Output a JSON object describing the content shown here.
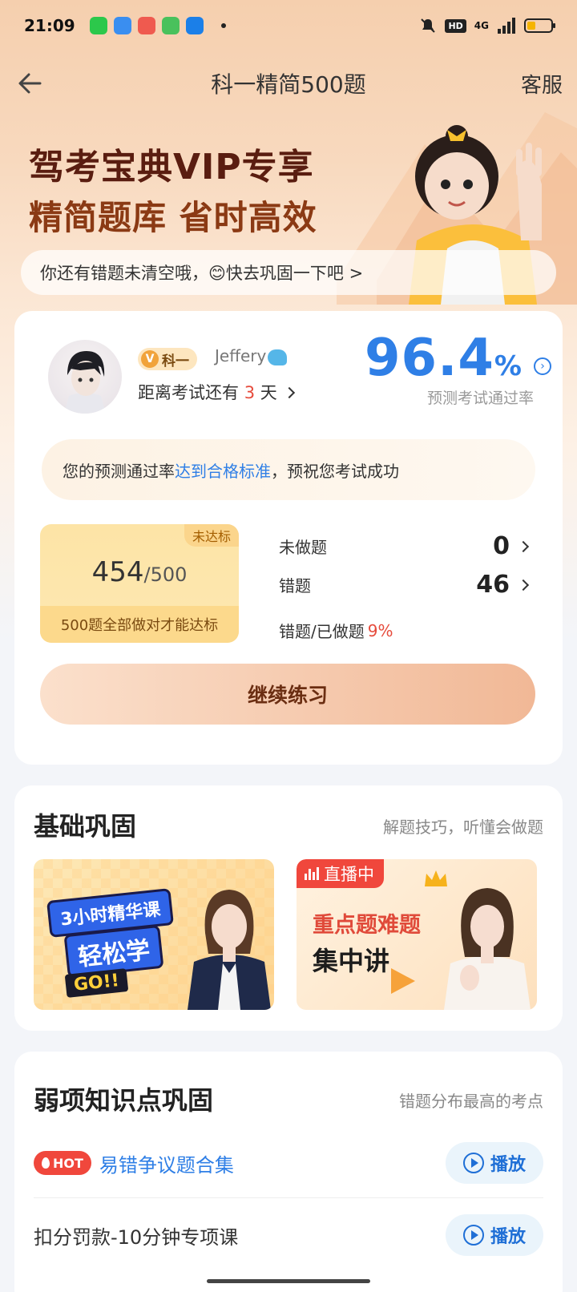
{
  "status_bar": {
    "time": "21:09",
    "hd": "HD",
    "network": "4G",
    "battery_level": 0.35
  },
  "nav": {
    "title": "科一精简500题",
    "right_label": "客服"
  },
  "hero": {
    "line1": "驾考宝典VIP专享",
    "line2": "精简题库 省时高效",
    "tip": "你还有错题未清空哦，😊快去巩固一下吧 >"
  },
  "profile": {
    "subject_badge": "科一",
    "username": "Jeffery",
    "days_prefix": "距离考试还有",
    "days_value": "3",
    "days_suffix": "天",
    "pass_rate_value": "96.4",
    "pass_rate_unit": "%",
    "pass_rate_label": "预测考试通过率"
  },
  "pass_message": {
    "before": "您的预测通过率",
    "highlight": "达到合格标准",
    "after": "，预祝您考试成功"
  },
  "progress": {
    "tag": "未达标",
    "done": "454",
    "total": "/500",
    "footer": "500题全部做对才能达标"
  },
  "stats": {
    "undone_label": "未做题",
    "undone_value": "0",
    "wrong_label": "错题",
    "wrong_value": "46",
    "ratio_label": "错题/已做题",
    "ratio_value": "9%"
  },
  "continue_button": "继续练习",
  "basic": {
    "title": "基础巩固",
    "subtitle": "解题技巧，听懂会做题",
    "promo_left": {
      "line1": "3小时精华课",
      "line2": "轻松学",
      "go": "GO!!"
    },
    "promo_right": {
      "live": "直播中",
      "line1": "重点题难题",
      "line2": "集中讲"
    }
  },
  "weak": {
    "title": "弱项知识点巩固",
    "subtitle": "错题分布最高的考点",
    "items": [
      {
        "tag": "HOT",
        "title": "易错争议题合集",
        "action": "播放"
      },
      {
        "title": "扣分罚款-10分钟专项课",
        "action": "播放"
      }
    ]
  },
  "colors": {
    "accent_blue": "#2f7fe6",
    "red": "#e64b3c",
    "hero_dark": "#5a1d10"
  }
}
